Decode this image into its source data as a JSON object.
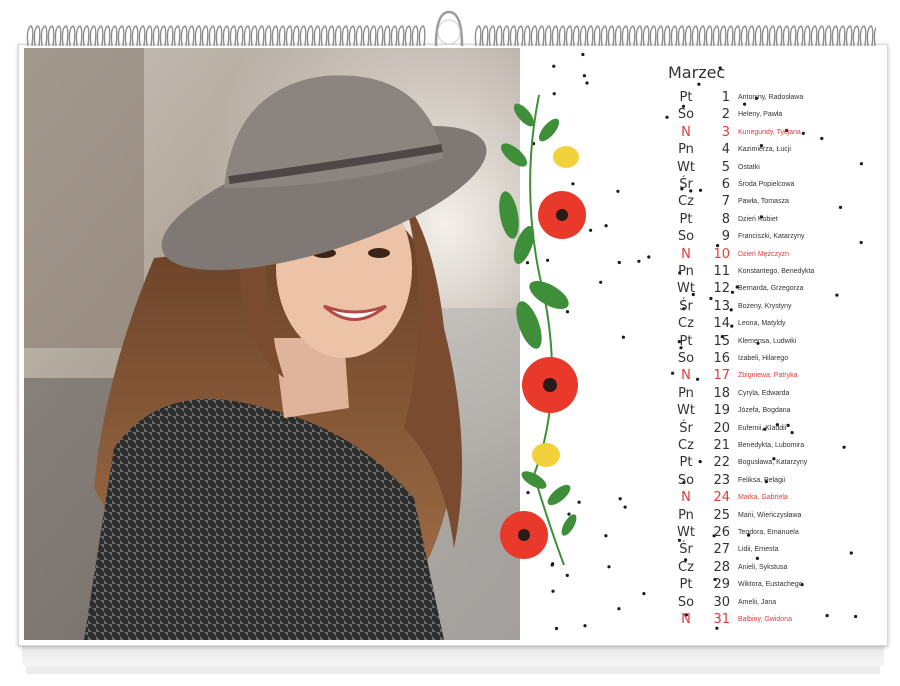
{
  "calendar": {
    "month": "Marzec",
    "days": [
      {
        "weekday": "Pt",
        "day": "1",
        "names": "Antoniny, Radosława",
        "holiday": false
      },
      {
        "weekday": "So",
        "day": "2",
        "names": "Heleny, Pawła",
        "holiday": false
      },
      {
        "weekday": "N",
        "day": "3",
        "names": "Kunegundy, Tycjana",
        "holiday": true
      },
      {
        "weekday": "Pn",
        "day": "4",
        "names": "Kazimierza, Łucji",
        "holiday": false
      },
      {
        "weekday": "Wt",
        "day": "5",
        "names": "Ostatki",
        "holiday": false
      },
      {
        "weekday": "Śr",
        "day": "6",
        "names": "Środa Popielcowa",
        "holiday": false
      },
      {
        "weekday": "Cz",
        "day": "7",
        "names": "Pawła, Tomasza",
        "holiday": false
      },
      {
        "weekday": "Pt",
        "day": "8",
        "names": "Dzień Kobiet",
        "holiday": false
      },
      {
        "weekday": "So",
        "day": "9",
        "names": "Franciszki, Katarzyny",
        "holiday": false
      },
      {
        "weekday": "N",
        "day": "10",
        "names": "Dzień Mężczyzn",
        "holiday": true
      },
      {
        "weekday": "Pn",
        "day": "11",
        "names": "Konstantego, Benedykta",
        "holiday": false
      },
      {
        "weekday": "Wt",
        "day": "12",
        "names": "Bernarda, Grzegorza",
        "holiday": false
      },
      {
        "weekday": "Śr",
        "day": "13",
        "names": "Bożeny, Krystyny",
        "holiday": false
      },
      {
        "weekday": "Cz",
        "day": "14",
        "names": "Leona, Matyldy",
        "holiday": false
      },
      {
        "weekday": "Pt",
        "day": "15",
        "names": "Klemensa, Ludwiki",
        "holiday": false
      },
      {
        "weekday": "So",
        "day": "16",
        "names": "Izabeli, Hilarego",
        "holiday": false
      },
      {
        "weekday": "N",
        "day": "17",
        "names": "Zbigniewa, Patryka",
        "holiday": true
      },
      {
        "weekday": "Pn",
        "day": "18",
        "names": "Cyryla, Edwarda",
        "holiday": false
      },
      {
        "weekday": "Wt",
        "day": "19",
        "names": "Józefa, Bogdana",
        "holiday": false
      },
      {
        "weekday": "Śr",
        "day": "20",
        "names": "Eufemii, Klaudii",
        "holiday": false
      },
      {
        "weekday": "Cz",
        "day": "21",
        "names": "Benedykta, Lubomira",
        "holiday": false
      },
      {
        "weekday": "Pt",
        "day": "22",
        "names": "Bogusława, Katarzyny",
        "holiday": false
      },
      {
        "weekday": "So",
        "day": "23",
        "names": "Feliksa, Pelagii",
        "holiday": false
      },
      {
        "weekday": "N",
        "day": "24",
        "names": "Marka, Gabriela",
        "holiday": true
      },
      {
        "weekday": "Pn",
        "day": "25",
        "names": "Marii, Wieńczysława",
        "holiday": false
      },
      {
        "weekday": "Wt",
        "day": "26",
        "names": "Teodora, Emanuela",
        "holiday": false
      },
      {
        "weekday": "Śr",
        "day": "27",
        "names": "Lidii, Ernesta",
        "holiday": false
      },
      {
        "weekday": "Cz",
        "day": "28",
        "names": "Anieli, Sykstusa",
        "holiday": false
      },
      {
        "weekday": "Pt",
        "day": "29",
        "names": "Wiktora, Eustachego",
        "holiday": false
      },
      {
        "weekday": "So",
        "day": "30",
        "names": "Amelii, Jana",
        "holiday": false
      },
      {
        "weekday": "N",
        "day": "31",
        "names": "Balbiny, Gwidona",
        "holiday": true
      }
    ]
  },
  "colors": {
    "holiday": "#e03c3c",
    "text": "#333333",
    "dots": "#1a1a1a",
    "poppy": "#e8392b",
    "leaf": "#3f8f3a"
  },
  "photo": {
    "subject": "smiling woman in grey hat and houndstooth coat"
  }
}
